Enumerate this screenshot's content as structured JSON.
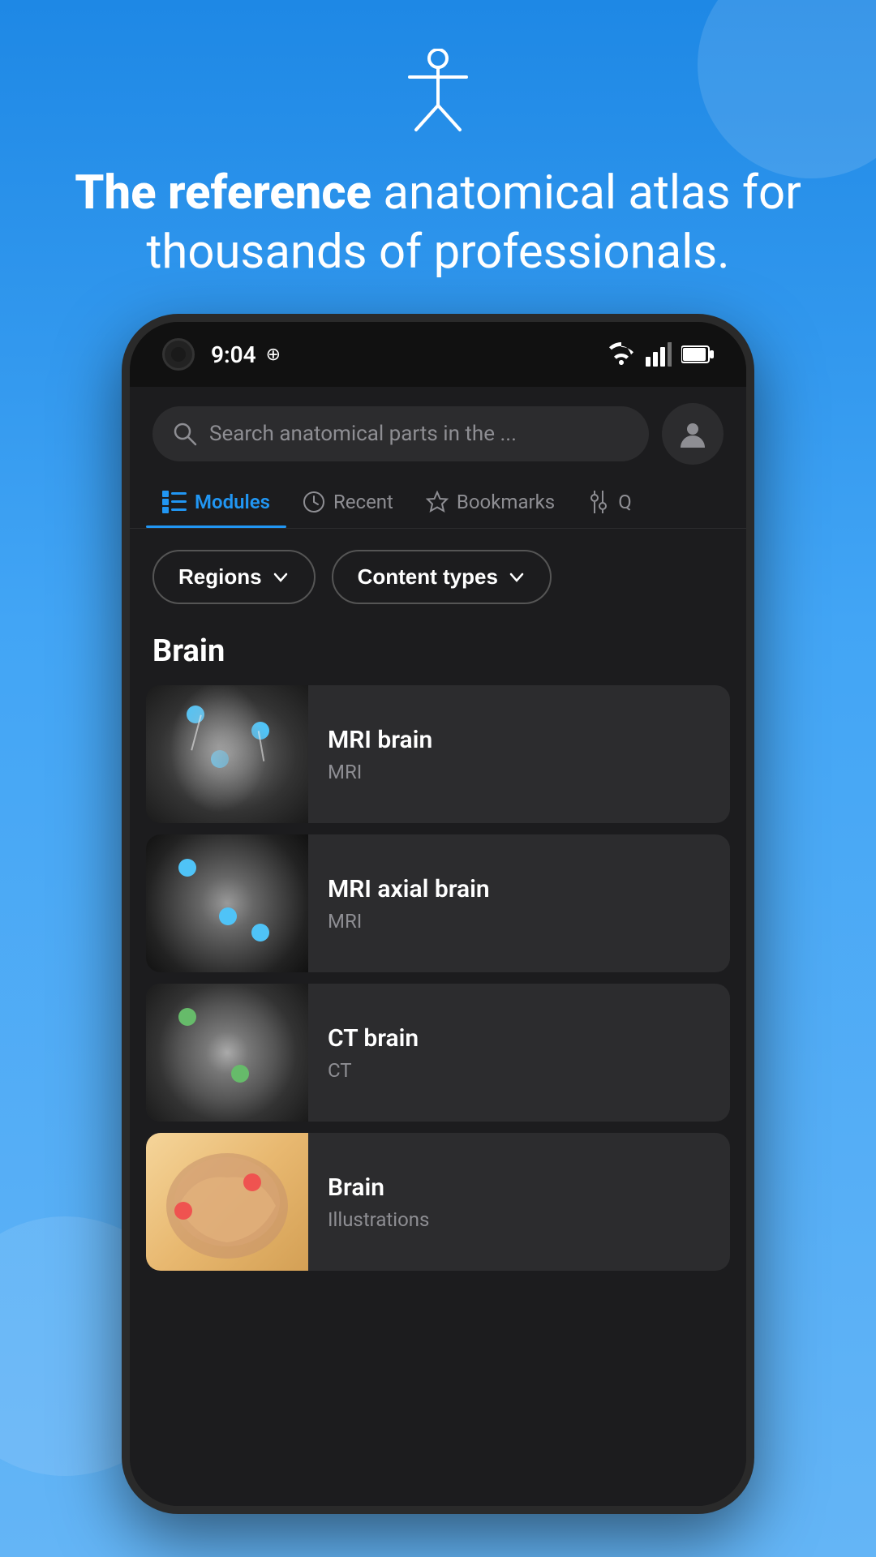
{
  "background": {
    "gradient_start": "#1E88E5",
    "gradient_end": "#64B5F6"
  },
  "header": {
    "title_bold": "The reference",
    "title_normal": " anatomical atlas for thousands of professionals.",
    "body_icon": "person-icon"
  },
  "status_bar": {
    "time": "9:04",
    "wifi": true,
    "signal": true,
    "battery": true
  },
  "search": {
    "placeholder": "Search anatomical parts in the ...",
    "search_icon": "search-icon",
    "profile_icon": "profile-icon"
  },
  "nav_tabs": [
    {
      "id": "modules",
      "label": "Modules",
      "icon": "modules-icon",
      "active": true
    },
    {
      "id": "recent",
      "label": "Recent",
      "icon": "clock-icon",
      "active": false
    },
    {
      "id": "bookmarks",
      "label": "Bookmarks",
      "icon": "star-icon",
      "active": false
    },
    {
      "id": "filter",
      "label": "Q",
      "icon": "filter-icon",
      "active": false
    }
  ],
  "filters": [
    {
      "id": "regions",
      "label": "Regions"
    },
    {
      "id": "content_types",
      "label": "Content types"
    }
  ],
  "sections": [
    {
      "title": "Brain",
      "modules": [
        {
          "id": "mri-brain",
          "name": "MRI brain",
          "type": "MRI",
          "image_type": "mri-brain"
        },
        {
          "id": "mri-axial-brain",
          "name": "MRI axial brain",
          "type": "MRI",
          "image_type": "mri-axial"
        },
        {
          "id": "ct-brain",
          "name": "CT brain",
          "type": "CT",
          "image_type": "ct-brain"
        },
        {
          "id": "brain-illustrations",
          "name": "Brain",
          "type": "Illustrations",
          "image_type": "illustration"
        }
      ]
    }
  ]
}
